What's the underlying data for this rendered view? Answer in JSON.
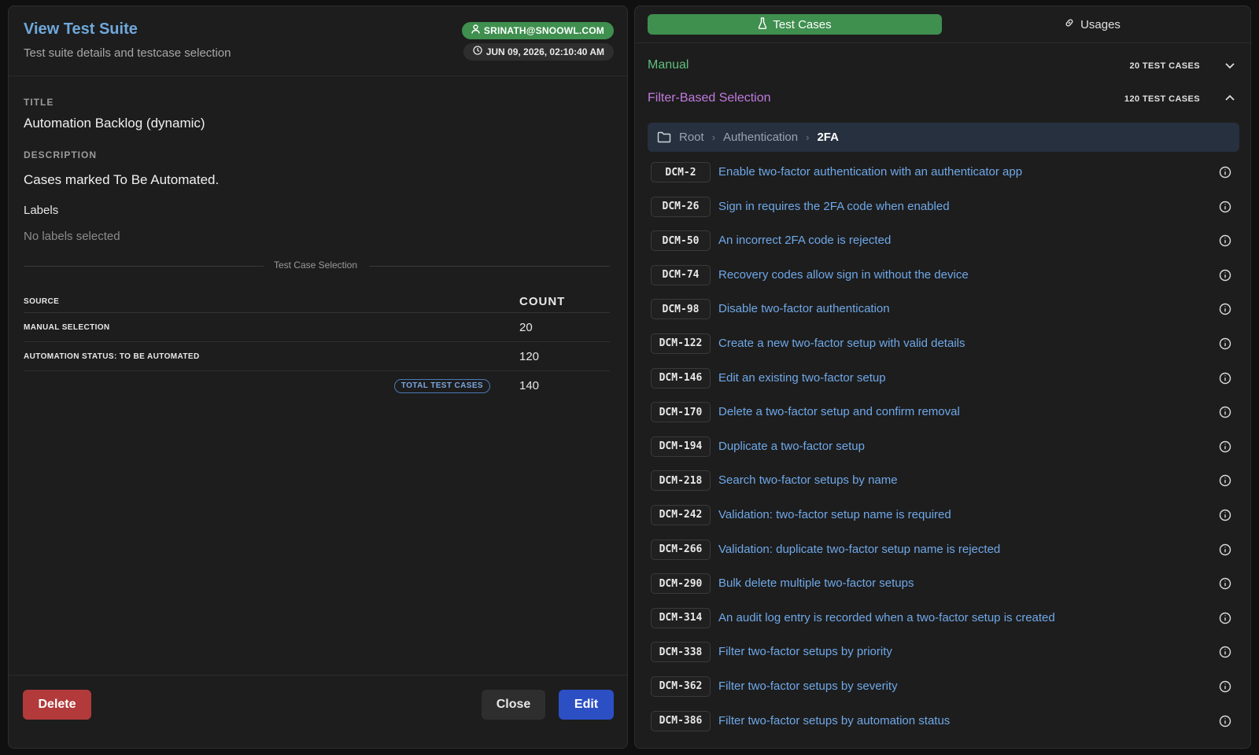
{
  "suite": {
    "heading": "View Test Suite",
    "subheading": "Test suite details and testcase selection",
    "user_badge": "SRINATH@SNOOWL.COM",
    "date_badge": "JUN 09, 2026, 02:10:40 AM",
    "title_label": "TITLE",
    "title_value": "Automation Backlog (dynamic)",
    "description_label": "DESCRIPTION",
    "description_value": "Cases marked To Be Automated.",
    "labels_heading": "Labels",
    "labels_empty": "No labels selected",
    "selection_divider": "Test Case Selection"
  },
  "selection_table": {
    "headers": [
      "SOURCE",
      "COUNT"
    ],
    "rows": [
      {
        "source": "MANUAL SELECTION",
        "count": "20"
      },
      {
        "source": "AUTOMATION STATUS: TO BE AUTOMATED",
        "count": "120"
      }
    ],
    "total_label": "TOTAL TEST CASES",
    "total_count": "140"
  },
  "footer": {
    "delete_label": "Delete",
    "close_label": "Close",
    "edit_label": "Edit"
  },
  "tabs": [
    {
      "label": "Test Cases",
      "icon": "flask-icon",
      "active": true
    },
    {
      "label": "Usages",
      "icon": "link-icon",
      "active": false
    }
  ],
  "sections": {
    "manual": {
      "title": "Manual",
      "count": "20 TEST CASES",
      "expanded": false,
      "color": "#5fbf7f"
    },
    "filter": {
      "title": "Filter-Based Selection",
      "count": "120 TEST CASES",
      "expanded": true,
      "color": "#c27be0"
    }
  },
  "breadcrumb": [
    "Root",
    "Authentication",
    "2FA"
  ],
  "cases": [
    {
      "id": "DCM-2",
      "title": "Enable two-factor authentication with an authenticator app"
    },
    {
      "id": "DCM-26",
      "title": "Sign in requires the 2FA code when enabled"
    },
    {
      "id": "DCM-50",
      "title": "An incorrect 2FA code is rejected"
    },
    {
      "id": "DCM-74",
      "title": "Recovery codes allow sign in without the device"
    },
    {
      "id": "DCM-98",
      "title": "Disable two-factor authentication"
    },
    {
      "id": "DCM-122",
      "title": "Create a new two-factor setup with valid details"
    },
    {
      "id": "DCM-146",
      "title": "Edit an existing two-factor setup"
    },
    {
      "id": "DCM-170",
      "title": "Delete a two-factor setup and confirm removal"
    },
    {
      "id": "DCM-194",
      "title": "Duplicate a two-factor setup"
    },
    {
      "id": "DCM-218",
      "title": "Search two-factor setups by name"
    },
    {
      "id": "DCM-242",
      "title": "Validation: two-factor setup name is required"
    },
    {
      "id": "DCM-266",
      "title": "Validation: duplicate two-factor setup name is rejected"
    },
    {
      "id": "DCM-290",
      "title": "Bulk delete multiple two-factor setups"
    },
    {
      "id": "DCM-314",
      "title": "An audit log entry is recorded when a two-factor setup is created"
    },
    {
      "id": "DCM-338",
      "title": "Filter two-factor setups by priority"
    },
    {
      "id": "DCM-362",
      "title": "Filter two-factor setups by severity"
    },
    {
      "id": "DCM-386",
      "title": "Filter two-factor setups by automation status"
    }
  ]
}
